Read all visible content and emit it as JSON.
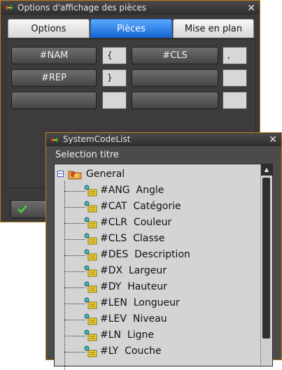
{
  "window1": {
    "title": "Options d'affichage des pièces",
    "close_glyph": "✕",
    "tabs": [
      {
        "label": "Options",
        "active": false
      },
      {
        "label": "Pièces",
        "active": true
      },
      {
        "label": "Mise en plan",
        "active": false
      }
    ],
    "grid": {
      "row1": {
        "left_button": "#NAM",
        "left_box": "{",
        "right_button": "#CLS",
        "right_box": ","
      },
      "row2": {
        "left_button": "#REP",
        "left_box": "}",
        "right_button": "",
        "right_box": ""
      },
      "row3": {
        "left_button": "",
        "left_box": "",
        "right_button": "",
        "right_box": ""
      }
    },
    "ok_icon": "check-icon"
  },
  "window2": {
    "title": "SystemCodeList",
    "close_glyph": "✕",
    "selection_label": "Selection titre",
    "tree": {
      "root_label": "General",
      "items": [
        "#ANG  Angle",
        "#CAT  Catégorie",
        "#CLR  Couleur",
        "#CLS  Classe",
        "#DES  Description",
        "#DX  Largeur",
        "#DY  Hauteur",
        "#LEN  Longueur",
        "#LEV  Niveau",
        "#LN  Ligne",
        "#LY  Couche"
      ]
    },
    "scroll_up_glyph": "▲"
  },
  "colors": {
    "window_border": "#c57a1f",
    "active_tab": "#1563d4",
    "panel": "#3c3c3c",
    "tree_background": "#d4d4d4"
  }
}
